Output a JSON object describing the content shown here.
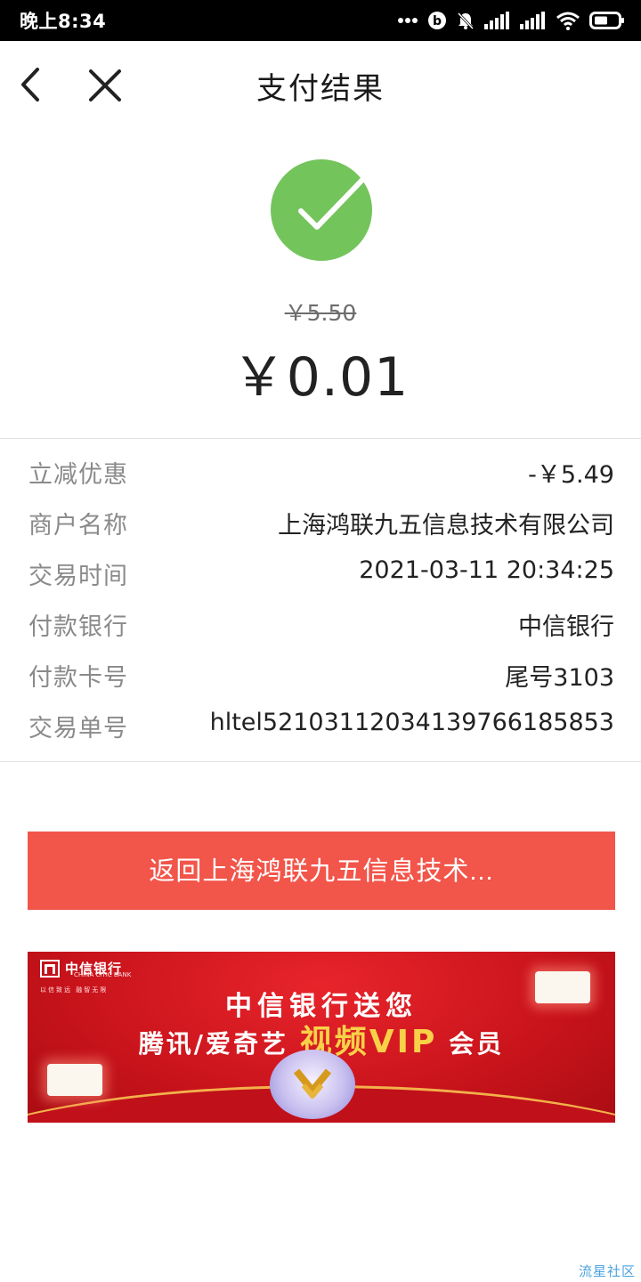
{
  "status_bar": {
    "time": "晚上8:34",
    "icons": [
      "more-dots-icon",
      "beats-icon",
      "mute-bell-icon",
      "signal-icon",
      "signal-icon",
      "wifi-icon",
      "battery-icon"
    ]
  },
  "nav": {
    "title": "支付结果",
    "back_icon": "chevron-left-icon",
    "close_icon": "close-icon"
  },
  "result": {
    "status_icon": "check-circle-icon",
    "status_color": "#74c45c",
    "original_price": "￥5.50",
    "paid_amount": "￥0.01"
  },
  "details": [
    {
      "label": "立减优惠",
      "value": "-￥5.49"
    },
    {
      "label": "商户名称",
      "value": "上海鸿联九五信息技术有限公司"
    },
    {
      "label": "交易时间",
      "value": "2021-03-11 20:34:25"
    },
    {
      "label": "付款银行",
      "value": "中信银行"
    },
    {
      "label": "付款卡号",
      "value": "尾号3103"
    },
    {
      "label": "交易单号",
      "value": "hltel52103112034139766185853"
    }
  ],
  "return_button": {
    "label": "返回上海鸿联九五信息技术...",
    "color": "#f2554a"
  },
  "banner": {
    "bank_name": "中信银行",
    "bank_english": "CHINA CITIC BANK",
    "bank_slogan": "以信致远 融智无限",
    "headline1": "中信银行送您",
    "headline2_prefix": "腾讯/爱奇艺",
    "headline2_highlight": "视频VIP",
    "headline2_suffix": "会员",
    "colors": {
      "background": "#c8131b",
      "highlight": "#f8d148"
    }
  },
  "watermark": "流星社区"
}
